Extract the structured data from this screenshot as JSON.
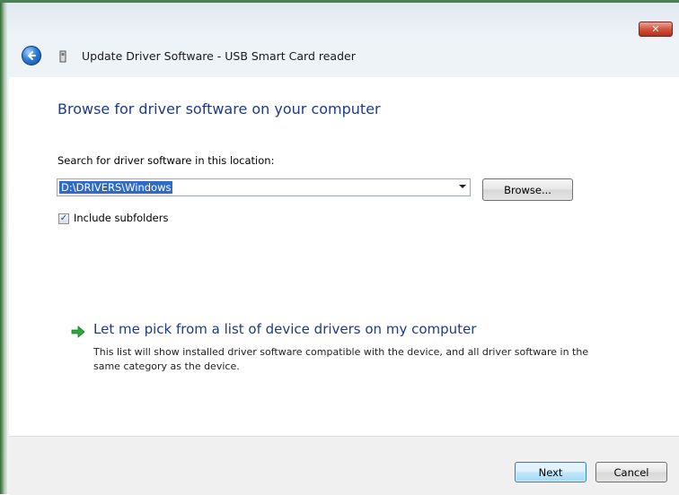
{
  "window": {
    "title": "Update Driver Software - USB Smart Card reader",
    "close_icon": "close-icon",
    "back_icon": "back-arrow-icon",
    "title_icon": "device-icon"
  },
  "main": {
    "heading": "Browse for driver software on your computer",
    "search_label": "Search for driver software in this location:",
    "path_value": "D:\\DRIVERS\\Windows",
    "browse_label": "Browse...",
    "include_subfolders_label": "Include subfolders",
    "include_subfolders_checked": true,
    "pick": {
      "title": "Let me pick from a list of device drivers on my computer",
      "description": "This list will show installed driver software compatible with the device, and all driver software in the same category as the device.",
      "icon": "green-arrow-icon"
    }
  },
  "footer": {
    "next_label": "Next",
    "cancel_label": "Cancel"
  },
  "colors": {
    "heading_blue": "#1e3a8c",
    "selection_blue": "#316ac5",
    "close_red": "#c8412c",
    "arrow_green": "#2da83a"
  }
}
